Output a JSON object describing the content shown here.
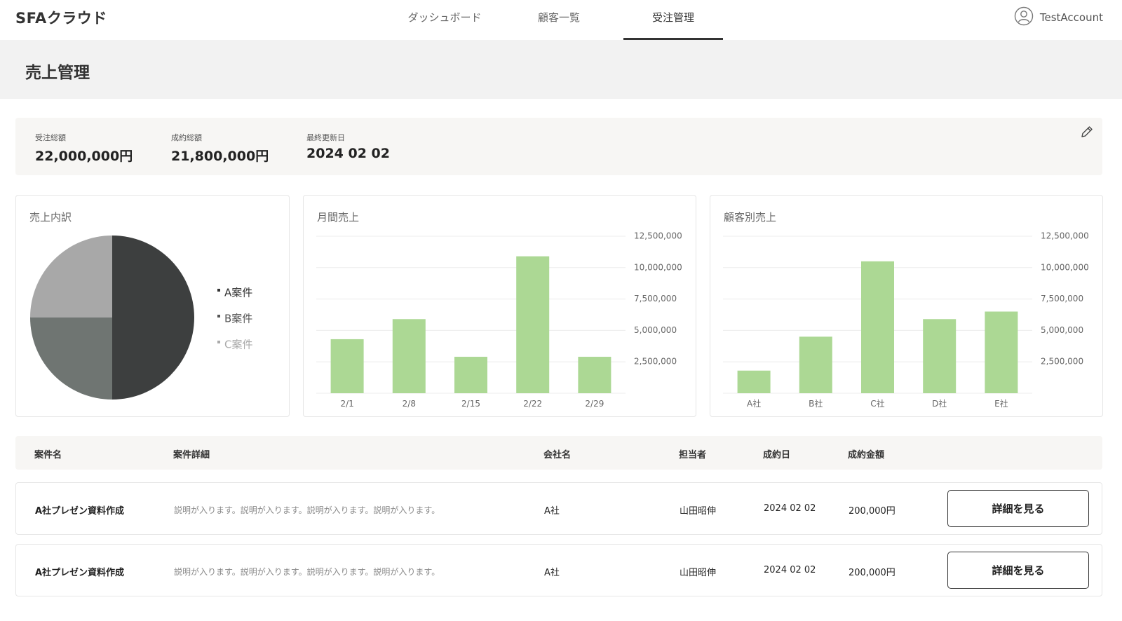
{
  "app": {
    "logo": "SFAクラウド"
  },
  "nav": {
    "tabs": [
      {
        "label": "ダッシュボード",
        "active": false
      },
      {
        "label": "顧客一覧",
        "active": false
      },
      {
        "label": "受注管理",
        "active": true
      }
    ]
  },
  "account": {
    "name": "TestAccount",
    "icon": "user-circle-icon"
  },
  "page": {
    "title": "売上管理"
  },
  "summary": {
    "stats": [
      {
        "label": "受注総額",
        "value": "22,000,000円"
      },
      {
        "label": "成約総額",
        "value": "21,800,000円"
      },
      {
        "label": "最終更新日",
        "value": "2024 02 02"
      }
    ],
    "edit_icon": "pencil-icon"
  },
  "cards": {
    "breakdown": {
      "title": "売上内訳"
    },
    "monthly": {
      "title": "月間売上"
    },
    "customer": {
      "title": "顧客別売上"
    }
  },
  "colors": {
    "bar": "#acd894",
    "grid": "#ececec",
    "pie": [
      "#3d3f3f",
      "#6f7572",
      "#a8a8a8"
    ]
  },
  "chart_data": [
    {
      "type": "pie",
      "title": "売上内訳",
      "categories": [
        "A案件",
        "B案件",
        "C案件"
      ],
      "values": [
        50,
        25,
        25
      ],
      "legend": "right"
    },
    {
      "type": "bar",
      "title": "月間売上",
      "categories": [
        "2/1",
        "2/8",
        "2/15",
        "2/22",
        "2/29"
      ],
      "values": [
        4300000,
        5900000,
        2900000,
        10900000,
        2900000
      ],
      "ylim": [
        0,
        12500000
      ],
      "yticks": [
        "2,500,000",
        "5,000,000",
        "7,500,000",
        "10,000,000",
        "12,500,000"
      ],
      "ytick_values": [
        2500000,
        5000000,
        7500000,
        10000000,
        12500000
      ],
      "axis_position": "right",
      "grid": true
    },
    {
      "type": "bar",
      "title": "顧客別売上",
      "categories": [
        "A社",
        "B社",
        "C社",
        "D社",
        "E社"
      ],
      "values": [
        1800000,
        4500000,
        10500000,
        5900000,
        6500000
      ],
      "ylim": [
        0,
        12500000
      ],
      "yticks": [
        "2,500,000",
        "5,000,000",
        "7,500,000",
        "10,000,000",
        "12,500,000"
      ],
      "ytick_values": [
        2500000,
        5000000,
        7500000,
        10000000,
        12500000
      ],
      "axis_position": "right",
      "grid": true
    }
  ],
  "table": {
    "headers": [
      "案件名",
      "案件詳細",
      "会社名",
      "担当者",
      "成約日",
      "成約金額"
    ],
    "rows": [
      {
        "name": "A社プレゼン資料作成",
        "detail": "説明が入ります。説明が入ります。説明が入ります。説明が入ります。",
        "company": "A社",
        "owner": "山田昭伸",
        "date": "2024 02 02",
        "amount": "200,000円",
        "button": "詳細を見る"
      },
      {
        "name": "A社プレゼン資料作成",
        "detail": "説明が入ります。説明が入ります。説明が入ります。説明が入ります。",
        "company": "A社",
        "owner": "山田昭伸",
        "date": "2024 02 02",
        "amount": "200,000円",
        "button": "詳細を見る"
      }
    ]
  }
}
